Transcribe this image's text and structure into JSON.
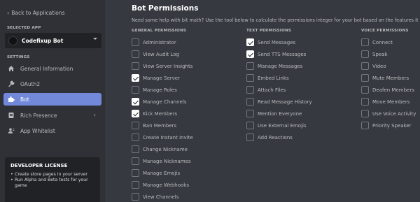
{
  "sidebar": {
    "back_label": "Back to Applications",
    "selected_app_label": "SELECTED APP",
    "selected_app_name": "Codefixup Bot",
    "settings_label": "SETTINGS",
    "items": [
      {
        "label": "General Information",
        "icon": "home-icon",
        "active": false
      },
      {
        "label": "OAuth2",
        "icon": "wrench-icon",
        "active": false
      },
      {
        "label": "Bot",
        "icon": "puzzle-icon",
        "active": true
      },
      {
        "label": "Rich Presence",
        "icon": "document-icon",
        "active": false
      },
      {
        "label": "App Whitelist",
        "icon": "user-list-icon",
        "active": false
      }
    ],
    "license": {
      "title": "DEVELOPER LICENSE",
      "items": [
        "Create store pages in your server",
        "Run Alpha and Beta tests for your game"
      ]
    }
  },
  "main": {
    "title": "Bot Permissions",
    "description": "Need some help with bit math? Use the tool below to calculate the permissions integer for your bot based on the features it needs.",
    "columns": [
      {
        "header": "GENERAL PERMISSIONS",
        "permissions": [
          {
            "label": "Administrator",
            "checked": false
          },
          {
            "label": "View Audit Log",
            "checked": false
          },
          {
            "label": "View Server Insights",
            "checked": false
          },
          {
            "label": "Manage Server",
            "checked": true
          },
          {
            "label": "Manage Roles",
            "checked": false
          },
          {
            "label": "Manage Channels",
            "checked": true
          },
          {
            "label": "Kick Members",
            "checked": true
          },
          {
            "label": "Ban Members",
            "checked": false
          },
          {
            "label": "Create Instant Invite",
            "checked": false
          },
          {
            "label": "Change Nickname",
            "checked": false
          },
          {
            "label": "Manage Nicknames",
            "checked": false
          },
          {
            "label": "Manage Emojis",
            "checked": false
          },
          {
            "label": "Manage Webhooks",
            "checked": false
          },
          {
            "label": "View Channels",
            "checked": false
          }
        ]
      },
      {
        "header": "TEXT PERMISSIONS",
        "permissions": [
          {
            "label": "Send Messages",
            "checked": true
          },
          {
            "label": "Send TTS Messages",
            "checked": true
          },
          {
            "label": "Manage Messages",
            "checked": false
          },
          {
            "label": "Embed Links",
            "checked": false
          },
          {
            "label": "Attach Files",
            "checked": false
          },
          {
            "label": "Read Message History",
            "checked": false
          },
          {
            "label": "Mention Everyone",
            "checked": false
          },
          {
            "label": "Use External Emojis",
            "checked": false
          },
          {
            "label": "Add Reactions",
            "checked": false
          }
        ]
      },
      {
        "header": "VOICE PERMISSIONS",
        "permissions": [
          {
            "label": "Connect",
            "checked": false
          },
          {
            "label": "Speak",
            "checked": false
          },
          {
            "label": "Video",
            "checked": false
          },
          {
            "label": "Mute Members",
            "checked": false
          },
          {
            "label": "Deafen Members",
            "checked": false
          },
          {
            "label": "Move Members",
            "checked": false
          },
          {
            "label": "Use Voice Activity",
            "checked": false
          },
          {
            "label": "Priority Speaker",
            "checked": false
          }
        ]
      }
    ]
  },
  "colors": {
    "sidebar_bg": "#2f3136",
    "main_bg": "#36393f",
    "accent": "#7289da",
    "card_bg": "#202225"
  }
}
